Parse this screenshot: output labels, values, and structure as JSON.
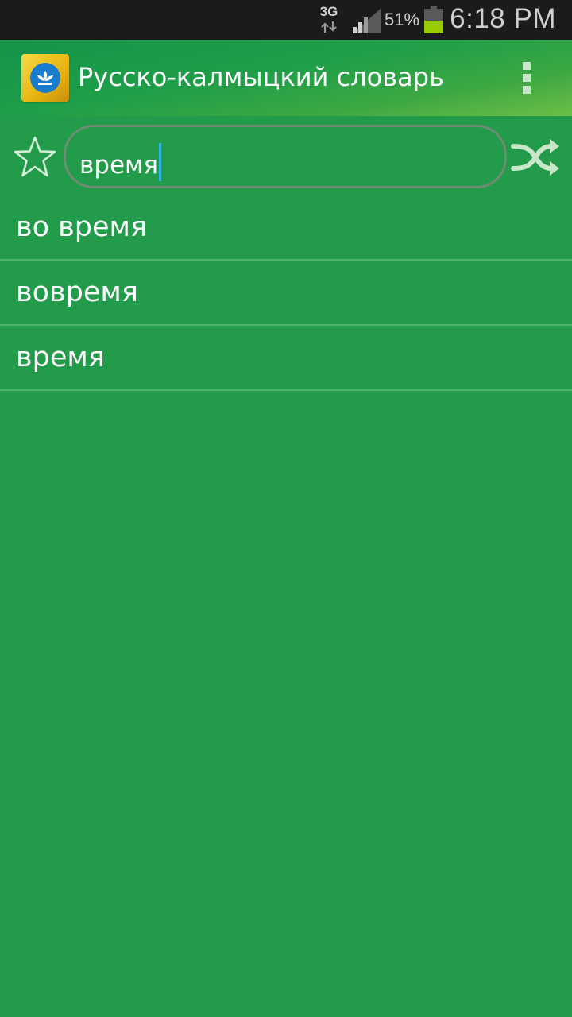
{
  "status_bar": {
    "network_type": "3G",
    "battery_percent": "51%",
    "battery_level": 0.51,
    "time": "6:18 PM",
    "icons": [
      "data-arrows-icon",
      "signal-icon",
      "battery-icon"
    ]
  },
  "action_bar": {
    "title": "Русско-калмыцкий словарь",
    "icons": [
      "app-logo-icon",
      "overflow-menu-icon"
    ]
  },
  "search": {
    "value": "время",
    "icons": [
      "star-icon",
      "shuffle-icon"
    ]
  },
  "results": [
    {
      "label": "во время"
    },
    {
      "label": "вовремя"
    },
    {
      "label": "время"
    }
  ],
  "colors": {
    "background": "#229c4a",
    "status_bar": "#1b1b1b",
    "caret": "#33b5e5",
    "battery_fill": "#99cc00"
  }
}
